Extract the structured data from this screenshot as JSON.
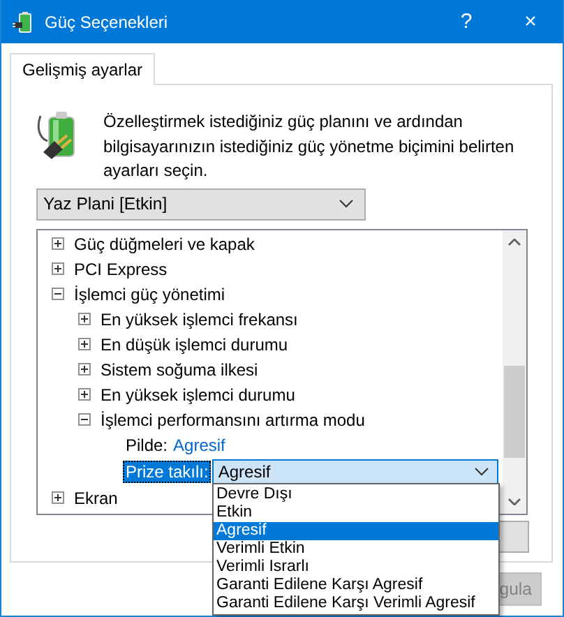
{
  "window": {
    "title": "Güç Seçenekleri",
    "help_button": "?",
    "close_button": "×"
  },
  "tabs": [
    {
      "label": "Gelişmiş ayarlar",
      "selected": true
    }
  ],
  "description": "Özelleştirmek istediğiniz güç planını ve ardından bilgisayarınızın istediğiniz güç yönetme biçimini belirten ayarları seçin.",
  "plan_select": {
    "value": "Yaz Plani [Etkin]"
  },
  "tree": [
    {
      "label": "Güç düğmeleri ve kapak",
      "expanded": false
    },
    {
      "label": "PCI Express",
      "expanded": false
    },
    {
      "label": "İşlemci güç yönetimi",
      "expanded": true,
      "children": [
        {
          "label": "En yüksek işlemci frekansı",
          "expanded": false
        },
        {
          "label": "En düşük işlemci durumu",
          "expanded": false
        },
        {
          "label": "Sistem soğuma ilkesi",
          "expanded": false
        },
        {
          "label": "En yüksek işlemci durumu",
          "expanded": false
        },
        {
          "label": "İşlemci performansını artırma modu",
          "expanded": true,
          "settings": [
            {
              "kind": "text",
              "label": "Pilde:",
              "value": "Agresif"
            },
            {
              "kind": "dropdown",
              "label": "Prize takılı:",
              "value": "Agresif"
            }
          ]
        }
      ]
    },
    {
      "label": "Ekran",
      "expanded": false
    }
  ],
  "dropdown_options": [
    {
      "label": "Devre Dışı",
      "selected": false
    },
    {
      "label": "Etkin",
      "selected": false
    },
    {
      "label": "Agresif",
      "selected": true
    },
    {
      "label": "Verimli Etkin",
      "selected": false
    },
    {
      "label": "Verimli Israrlı",
      "selected": false
    },
    {
      "label": "Garanti Edilene Karşı Agresif",
      "selected": false
    },
    {
      "label": "Garanti Edilene Karşı Verimli Agresif",
      "selected": false
    }
  ],
  "buttons": [
    {
      "label": "gula",
      "disabled": true
    }
  ]
}
